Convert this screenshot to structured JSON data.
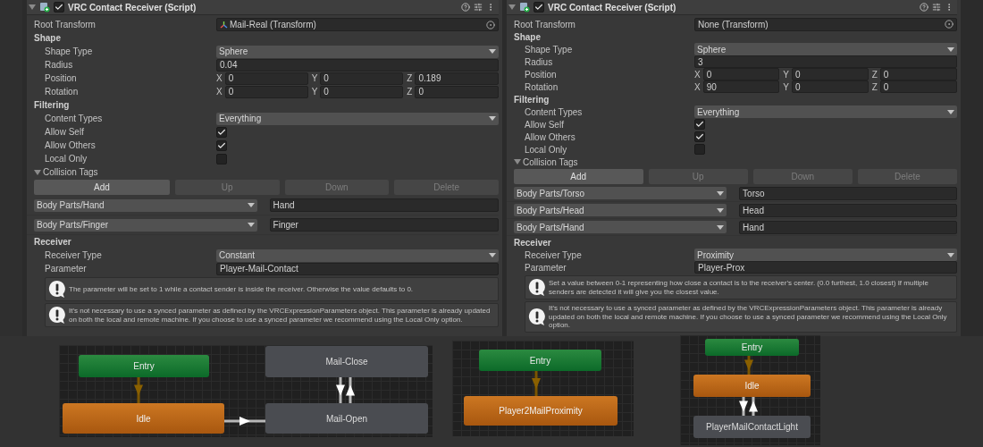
{
  "inspectors": [
    {
      "title": "VRC Contact Receiver (Script)",
      "enabled": true,
      "rows": [
        {
          "kind": "object",
          "label": "Root Transform",
          "value": "Mail-Real (Transform)",
          "has_icon": true
        },
        {
          "kind": "section",
          "label": "Shape"
        },
        {
          "kind": "dropdown",
          "label": "Shape Type",
          "value": "Sphere"
        },
        {
          "kind": "text",
          "label": "Radius",
          "value": "0.04"
        },
        {
          "kind": "vector",
          "label": "Position",
          "axes": [
            {
              "axis": "X",
              "value": "0"
            },
            {
              "axis": "Y",
              "value": "0"
            },
            {
              "axis": "Z",
              "value": "0.189"
            }
          ]
        },
        {
          "kind": "vector",
          "label": "Rotation",
          "axes": [
            {
              "axis": "X",
              "value": "0"
            },
            {
              "axis": "Y",
              "value": "0"
            },
            {
              "axis": "Z",
              "value": "0"
            }
          ]
        },
        {
          "kind": "section",
          "label": "Filtering"
        },
        {
          "kind": "dropdown",
          "label": "Content Types",
          "value": "Everything"
        },
        {
          "kind": "checkbox",
          "label": "Allow Self",
          "checked": true
        },
        {
          "kind": "checkbox",
          "label": "Allow Others",
          "checked": true
        },
        {
          "kind": "checkbox",
          "label": "Local Only",
          "checked": false
        },
        {
          "kind": "foldout",
          "label": "Collision Tags",
          "expanded": true
        },
        {
          "kind": "buttons",
          "buttons": [
            {
              "label": "Add",
              "disabled": false
            },
            {
              "label": "Up",
              "disabled": true
            },
            {
              "label": "Down",
              "disabled": true
            },
            {
              "label": "Delete",
              "disabled": true
            }
          ]
        },
        {
          "kind": "tag",
          "category": "Body Parts/Hand",
          "value": "Hand"
        },
        {
          "kind": "tag",
          "category": "Body Parts/Finger",
          "value": "Finger"
        },
        {
          "kind": "section",
          "label": "Receiver"
        },
        {
          "kind": "dropdown",
          "label": "Receiver Type",
          "value": "Constant"
        },
        {
          "kind": "text",
          "label": "Parameter",
          "value": "Player-Mail-Contact"
        },
        {
          "kind": "info",
          "text": "The parameter will be set to 1 while a contact sender is inside the receiver.  Otherwise the value defaults to 0."
        },
        {
          "kind": "info",
          "text": "It's not necessary to use a synced parameter as defined by the VRCExpressionParameters object.  This parameter is already updated on both the local and remote machine.  If you choose to use a synced parameter we recommend using the Local Only option."
        }
      ]
    },
    {
      "title": "VRC Contact Receiver (Script)",
      "enabled": true,
      "rows": [
        {
          "kind": "object",
          "label": "Root Transform",
          "value": "None (Transform)",
          "has_icon": false
        },
        {
          "kind": "section",
          "label": "Shape"
        },
        {
          "kind": "dropdown",
          "label": "Shape Type",
          "value": "Sphere"
        },
        {
          "kind": "text",
          "label": "Radius",
          "value": "3"
        },
        {
          "kind": "vector",
          "label": "Position",
          "axes": [
            {
              "axis": "X",
              "value": "0"
            },
            {
              "axis": "Y",
              "value": "0"
            },
            {
              "axis": "Z",
              "value": "0"
            }
          ]
        },
        {
          "kind": "vector",
          "label": "Rotation",
          "axes": [
            {
              "axis": "X",
              "value": "90"
            },
            {
              "axis": "Y",
              "value": "0"
            },
            {
              "axis": "Z",
              "value": "0"
            }
          ]
        },
        {
          "kind": "section",
          "label": "Filtering"
        },
        {
          "kind": "dropdown",
          "label": "Content Types",
          "value": "Everything"
        },
        {
          "kind": "checkbox",
          "label": "Allow Self",
          "checked": true
        },
        {
          "kind": "checkbox",
          "label": "Allow Others",
          "checked": true
        },
        {
          "kind": "checkbox",
          "label": "Local Only",
          "checked": false
        },
        {
          "kind": "foldout",
          "label": "Collision Tags",
          "expanded": true
        },
        {
          "kind": "buttons",
          "buttons": [
            {
              "label": "Add",
              "disabled": false
            },
            {
              "label": "Up",
              "disabled": true
            },
            {
              "label": "Down",
              "disabled": true
            },
            {
              "label": "Delete",
              "disabled": true
            }
          ]
        },
        {
          "kind": "tag",
          "category": "Body Parts/Torso",
          "value": "Torso"
        },
        {
          "kind": "tag",
          "category": "Body Parts/Head",
          "value": "Head"
        },
        {
          "kind": "tag",
          "category": "Body Parts/Hand",
          "value": "Hand"
        },
        {
          "kind": "section",
          "label": "Receiver"
        },
        {
          "kind": "dropdown",
          "label": "Receiver Type",
          "value": "Proximity"
        },
        {
          "kind": "text",
          "label": "Parameter",
          "value": "Player-Prox"
        },
        {
          "kind": "info",
          "text": "Set a value between 0-1 representing how close a contact is to the receiver's center. (0.0 furthest, 1.0 closest)  If multiple senders are detected it will give you the closest value."
        },
        {
          "kind": "info",
          "text": "It's not necessary to use a synced parameter as defined by the VRCExpressionParameters object.  This parameter is already updated on both the local and remote machine.  If you choose to use a synced parameter we recommend using the Local Only option."
        }
      ]
    }
  ],
  "graphs": [
    {
      "nodes": [
        {
          "label": "Entry",
          "kind": "entry"
        },
        {
          "label": "Mail-Close",
          "kind": "state"
        },
        {
          "label": "Idle",
          "kind": "default"
        },
        {
          "label": "Mail-Open",
          "kind": "state"
        }
      ]
    },
    {
      "nodes": [
        {
          "label": "Entry",
          "kind": "entry"
        },
        {
          "label": "Player2MailProximity",
          "kind": "default"
        }
      ]
    },
    {
      "nodes": [
        {
          "label": "Entry",
          "kind": "entry"
        },
        {
          "label": "Idle",
          "kind": "default"
        },
        {
          "label": "PlayerMailContactLight",
          "kind": "state"
        }
      ]
    }
  ]
}
